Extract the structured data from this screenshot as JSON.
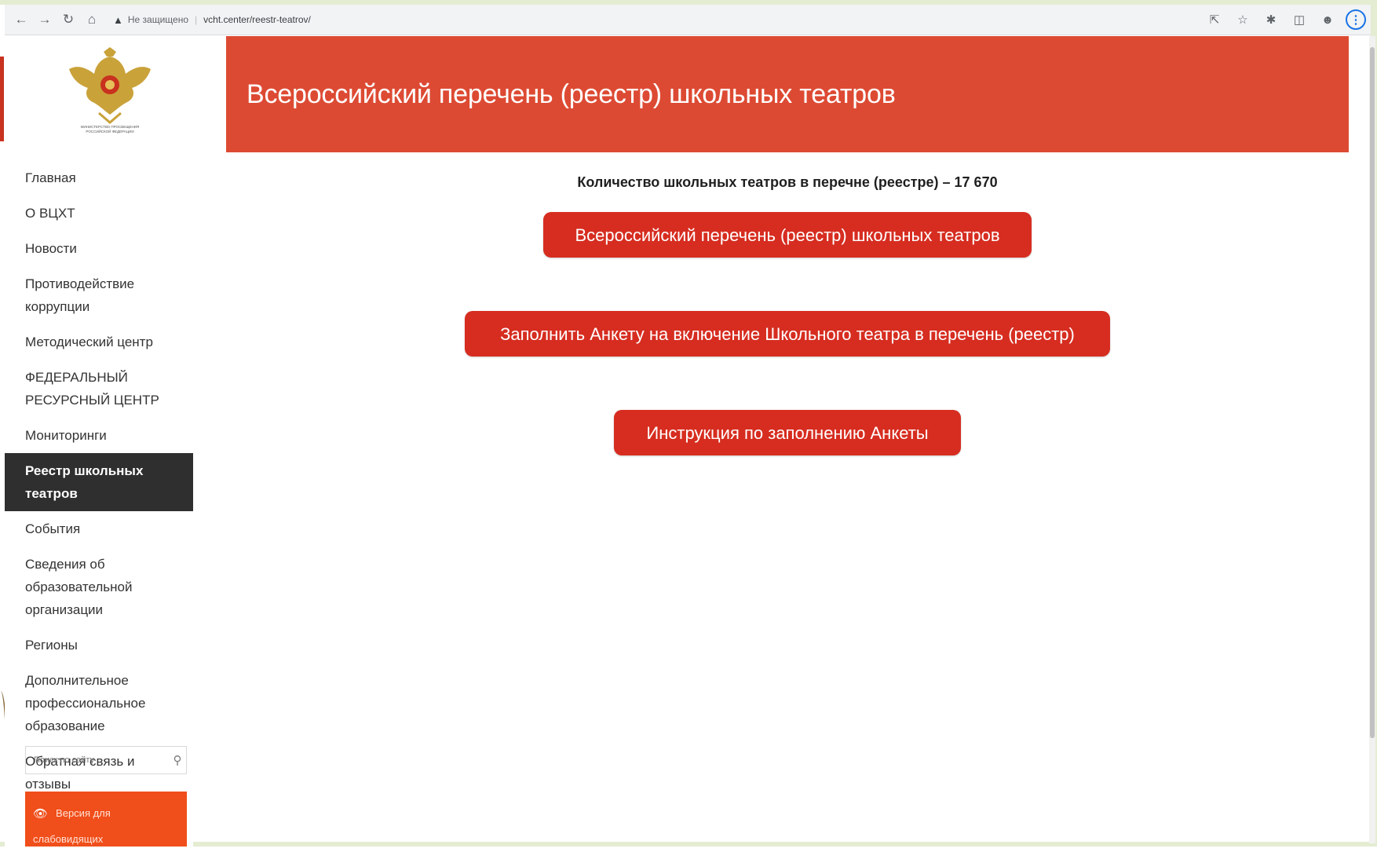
{
  "browser": {
    "security_label": "Не защищено",
    "url": "vcht.center/reestr-teatrov/"
  },
  "sidebar": {
    "logo_text": "МИНИСТЕРСТВО ПРОСВЕЩЕНИЯ РОССИЙСКОЙ ФЕДЕРАЦИИ",
    "items": [
      {
        "label": "Главная"
      },
      {
        "label": "О ВЦХТ"
      },
      {
        "label": "Новости"
      },
      {
        "label": "Противодействие коррупции"
      },
      {
        "label": "Методический центр"
      },
      {
        "label": "ФЕДЕРАЛЬНЫЙ РЕСУРСНЫЙ ЦЕНТР"
      },
      {
        "label": "Мониторинги"
      },
      {
        "label": "Реестр школьных театров"
      },
      {
        "label": "События"
      },
      {
        "label": "Сведения об образовательной организации"
      },
      {
        "label": "Регионы"
      },
      {
        "label": "Дополнительное профессиональное образование"
      },
      {
        "label": "Обратная связь и отзывы"
      }
    ],
    "active_index": 7,
    "search_placeholder": "Поиск по сайту",
    "vision_label": "Версия для слабовидящих"
  },
  "main": {
    "banner_title": "Всероссийский перечень (реестр) школьных театров",
    "count_text": "Количество школьных театров в перечне (реестре) – 17 670",
    "buttons": [
      {
        "label": "Всероссийский перечень (реестр) школьных театров"
      },
      {
        "label": "Заполнить Анкету на включение Школьного театра в перечень (реестр)"
      },
      {
        "label": "Инструкция по заполнению Анкеты"
      }
    ]
  },
  "colors": {
    "banner": "#dd4a33",
    "button": "#d62d20",
    "active_nav": "#2f2f2f",
    "vision_button": "#f04e1a"
  }
}
